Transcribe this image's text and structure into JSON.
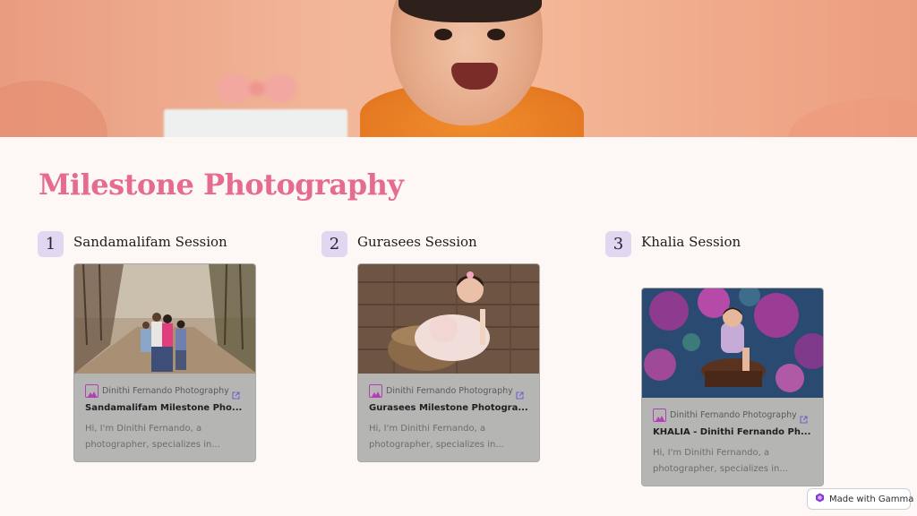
{
  "hero": {
    "image": "baby-milestone-banner"
  },
  "page": {
    "title": "Milestone Photography"
  },
  "items": [
    {
      "number": "1",
      "title": "Sandamalifam Session",
      "card": {
        "source": "Dinithi Fernando Photography",
        "title": "Sandamalifam Milestone Pho...",
        "description": "Hi, I'm Dinithi Fernando, a photographer, specializes in..."
      }
    },
    {
      "number": "2",
      "title": "Gurasees Session",
      "card": {
        "source": "Dinithi Fernando Photography",
        "title": "Gurasees Milestone Photogra...",
        "description": "Hi, I'm Dinithi Fernando, a photographer, specializes in..."
      }
    },
    {
      "number": "3",
      "title": "Khalia Session",
      "card": {
        "source": "Dinithi Fernando Photography",
        "title": "KHALIA - Dinithi Fernando Ph...",
        "description": "Hi, I'm Dinithi Fernando, a photographer, specializes in..."
      }
    }
  ],
  "badge": {
    "label": "Made with Gamma",
    "icon": "gamma-logo-icon"
  },
  "colors": {
    "accent": "#e56b91",
    "number_bg": "#e2d7f0",
    "card_bg": "#b5b5b3",
    "source_icon": "#b23fb6"
  }
}
